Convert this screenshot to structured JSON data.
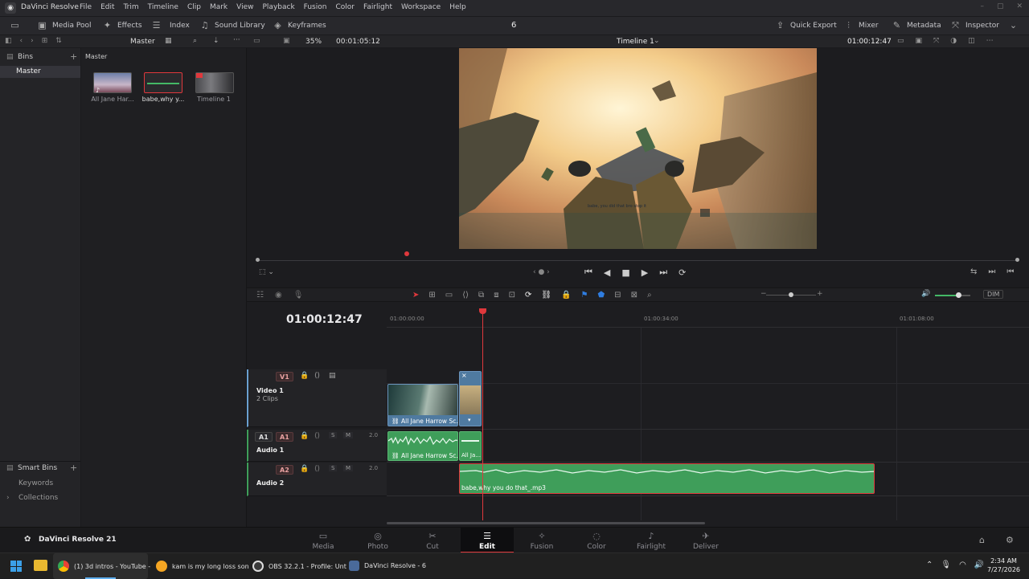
{
  "app": {
    "title": "DaVinci Resolve"
  },
  "menu": [
    "File",
    "Edit",
    "Trim",
    "Timeline",
    "Clip",
    "Mark",
    "View",
    "Playback",
    "Fusion",
    "Color",
    "Fairlight",
    "Workspace",
    "Help"
  ],
  "toolbar": {
    "media_pool": "Media Pool",
    "effects": "Effects",
    "index": "Index",
    "sound_library": "Sound Library",
    "keyframes": "Keyframes",
    "center_num": "6",
    "quick_export": "Quick Export",
    "mixer": "Mixer",
    "metadata": "Metadata",
    "inspector": "Inspector"
  },
  "subbar": {
    "master": "Master",
    "zoom": "35%",
    "timecode_left": "00:01:05:12",
    "timeline_name": "Timeline 1",
    "timecode_right": "01:00:12:47"
  },
  "bins": {
    "title": "Bins",
    "master": "Master",
    "smart_bins": "Smart Bins",
    "keywords": "Keywords",
    "collections": "Collections"
  },
  "mediapool": {
    "path": "Master",
    "clips": [
      "All Jane Har...",
      "babe,why y...",
      "Timeline 1"
    ]
  },
  "viewer": {
    "subtitle": "babe, you did that bro stop it"
  },
  "timeline": {
    "timecode": "01:00:12:47",
    "ruler": [
      "01:00:00:00",
      "01:00:34:00",
      "01:01:08:00"
    ],
    "dim": "DIM",
    "video1": {
      "badge": "V1",
      "name": "Video 1",
      "clips_count": "2 Clips",
      "clip_label": "All Jane Harrow Sc..."
    },
    "audio1": {
      "badge_a": "A1",
      "badge_b": "A1",
      "name": "Audio 1",
      "level": "2.0",
      "s": "S",
      "m": "M",
      "clip_label": "All Jane Harrow Sc...",
      "clip_label2": "All Ja..."
    },
    "audio2": {
      "badge": "A2",
      "name": "Audio 2",
      "level": "2.0",
      "s": "S",
      "m": "M",
      "clip_label": "babe,why you do that_.mp3"
    }
  },
  "pagebar": {
    "product": "DaVinci Resolve 21",
    "pages": [
      "Media",
      "Photo",
      "Cut",
      "Edit",
      "Fusion",
      "Color",
      "Fairlight",
      "Deliver"
    ],
    "active": "Edit"
  },
  "taskbar": {
    "items": [
      "(1) 3d intros - YouTube -",
      "kam is my long loss son",
      "OBS 32.2.1 - Profile: Unt",
      "DaVinci Resolve - 6"
    ],
    "time": "2:34 AM",
    "date": "7/27/2026"
  },
  "colors": {
    "accent_red": "#e0383c",
    "video_clip": "#4f7aa0",
    "audio_clip": "#3f9e5a",
    "active_track": "#6aa0d0"
  }
}
